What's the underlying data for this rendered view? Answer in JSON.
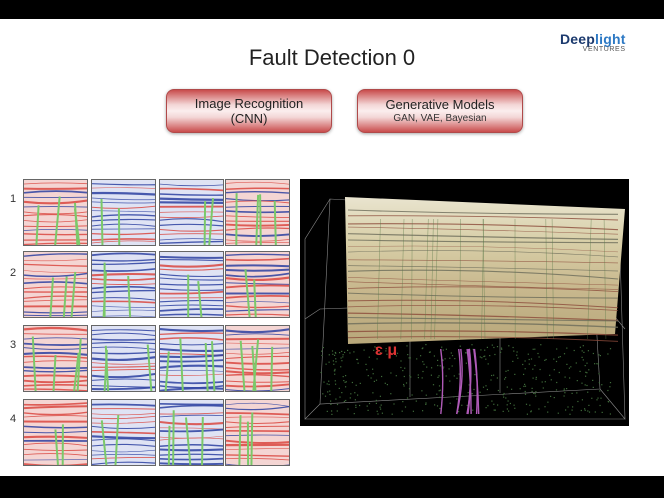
{
  "slide": {
    "title": "Fault Detection 0",
    "logo": {
      "main_dark": "Deep",
      "main_light": "light",
      "sub": "VENTURES"
    }
  },
  "buttons": [
    {
      "line1": "Image Recognition",
      "line2": "(CNN)"
    },
    {
      "line1": "Generative Models",
      "line2": "GAN, VAE, Bayesian"
    }
  ],
  "grid": {
    "row_labels": [
      "1",
      "2",
      "3",
      "4"
    ],
    "column_palettes": [
      "red",
      "blue",
      "blue",
      "red"
    ],
    "colors": {
      "red": "#d9473f",
      "blue": "#2c3fa0",
      "fault": "#7bc96a"
    }
  }
}
